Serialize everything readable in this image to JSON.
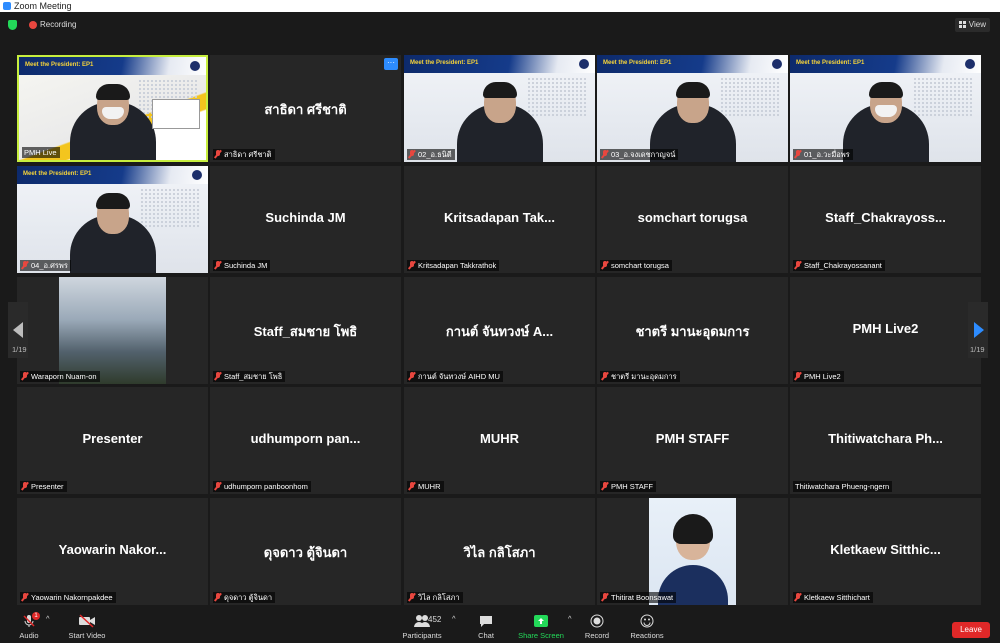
{
  "window": {
    "title": "Zoom Meeting"
  },
  "top": {
    "recording": "Recording",
    "view": "View"
  },
  "gallery": {
    "page": "1/19",
    "tiles": [
      {
        "label": "PMH Live",
        "center": "",
        "muted": false,
        "video": true,
        "active": true
      },
      {
        "label": "สาธิดา ศรีชาติ",
        "center": "สาธิดา ศรีชาติ",
        "muted": true,
        "video": false
      },
      {
        "label": "02_อ.ธนิตี",
        "center": "",
        "muted": true,
        "video": true
      },
      {
        "label": "03_อ.จงเดชกาญจน์",
        "center": "",
        "muted": true,
        "video": true
      },
      {
        "label": "01_อ.วะมื่อพร",
        "center": "",
        "muted": true,
        "video": true
      },
      {
        "label": "04_อ.ศรพร",
        "center": "",
        "muted": true,
        "video": true
      },
      {
        "label": "Suchinda JM",
        "center": "Suchinda JM",
        "muted": true,
        "video": false
      },
      {
        "label": "Kritsadapan Takkrathok",
        "center": "Kritsadapan Tak...",
        "muted": true,
        "video": false
      },
      {
        "label": "somchart torugsa",
        "center": "somchart torugsa",
        "muted": true,
        "video": false
      },
      {
        "label": "Staff_Chakrayossanant",
        "center": "Staff_Chakrayoss...",
        "muted": true,
        "video": false
      },
      {
        "label": "Waraporn Nuam-on",
        "center": "",
        "muted": true,
        "video": true
      },
      {
        "label": "Staff_สมชาย โพธิ",
        "center": "Staff_สมชาย โพธิ",
        "muted": true,
        "video": false
      },
      {
        "label": "กานต์ จันทวงษ์ AIHD MU",
        "center": "กานต์ จันทวงษ์ A...",
        "muted": true,
        "video": false
      },
      {
        "label": "ชาตรี มานะอุดมการ",
        "center": "ชาตรี มานะอุดมการ",
        "muted": true,
        "video": false
      },
      {
        "label": "PMH Live2",
        "center": "PMH Live2",
        "muted": true,
        "video": false
      },
      {
        "label": "Presenter",
        "center": "Presenter",
        "muted": true,
        "video": false
      },
      {
        "label": "udhumporn panboonhom",
        "center": "udhumporn pan...",
        "muted": true,
        "video": false
      },
      {
        "label": "MUHR",
        "center": "MUHR",
        "muted": true,
        "video": false
      },
      {
        "label": "PMH STAFF",
        "center": "PMH STAFF",
        "muted": true,
        "video": false
      },
      {
        "label": "Thitiwatchara Phueng-ngern",
        "center": "Thitiwatchara Ph...",
        "muted": false,
        "video": false
      },
      {
        "label": "Yaowarin Nakornpakdee",
        "center": "Yaowarin Nakor...",
        "muted": true,
        "video": false
      },
      {
        "label": "ดุจดาว ตู้จินดา",
        "center": "ดุจดาว ตู้จินดา",
        "muted": true,
        "video": false
      },
      {
        "label": "วิไล กลิโสภา",
        "center": "วิไล กลิโสภา",
        "muted": true,
        "video": false
      },
      {
        "label": "Thitirat Boonsawat",
        "center": "",
        "muted": true,
        "video": true
      },
      {
        "label": "Kletkaew Sitthichart",
        "center": "Kletkaew Sitthic...",
        "muted": true,
        "video": false
      }
    ],
    "banner_text": "Meet the President: EP1"
  },
  "toolbar": {
    "audio": "Audio",
    "start_video": "Start Video",
    "participants": "Participants",
    "participants_count": "452",
    "chat": "Chat",
    "share_screen": "Share Screen",
    "record": "Record",
    "reactions": "Reactions",
    "leave": "Leave",
    "audio_badge": "1"
  },
  "colors": {
    "accent": "#2d8cff",
    "active_border": "#c7ee3e",
    "share_green": "#23d959",
    "leave_red": "#e02828"
  }
}
